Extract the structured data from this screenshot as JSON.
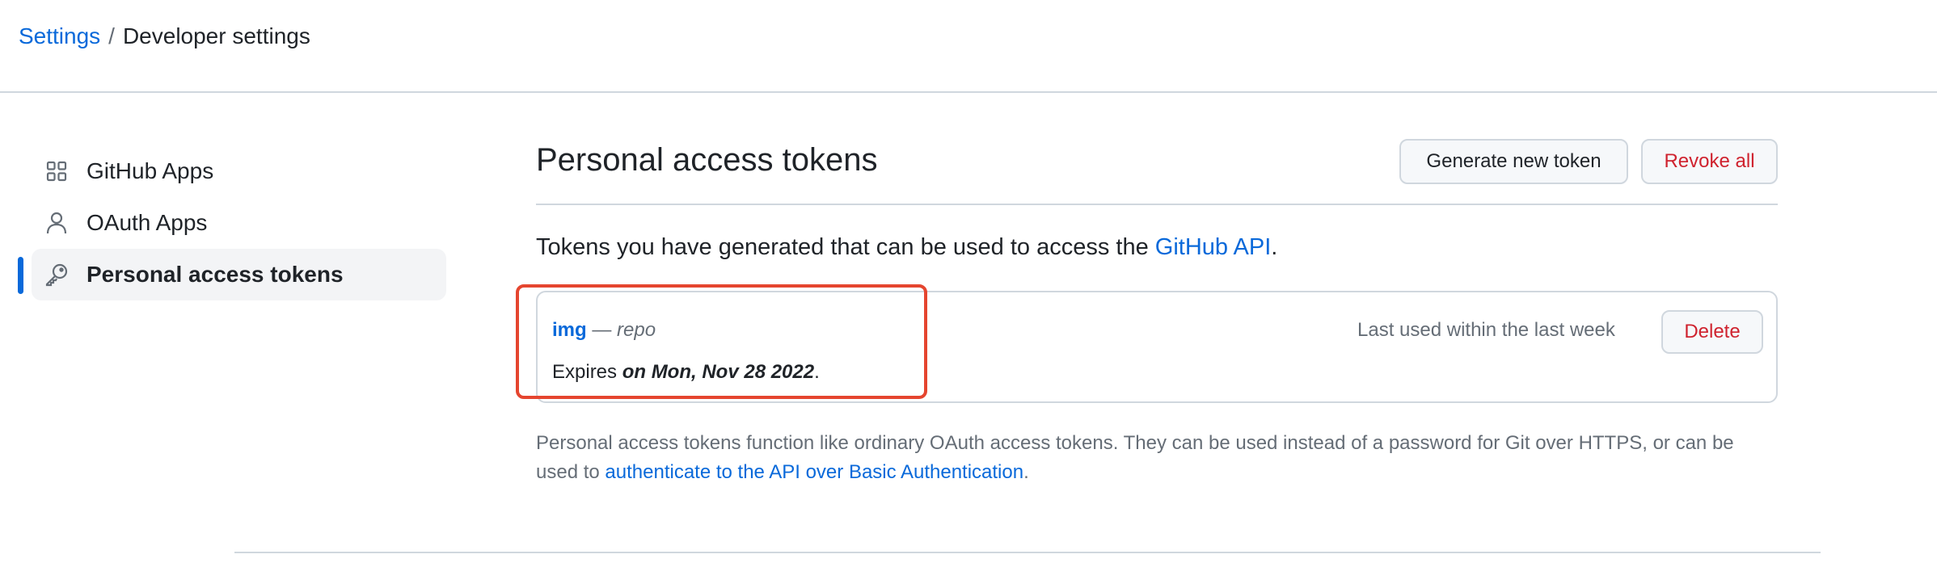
{
  "breadcrumb": {
    "root": "Settings",
    "separator": "/",
    "current": "Developer settings"
  },
  "sidebar": {
    "items": [
      {
        "label": "GitHub Apps",
        "icon": "apps-grid-icon"
      },
      {
        "label": "OAuth Apps",
        "icon": "person-icon"
      },
      {
        "label": "Personal access tokens",
        "icon": "key-icon",
        "active": true
      }
    ]
  },
  "main": {
    "title": "Personal access tokens",
    "generate_label": "Generate new token",
    "revoke_all_label": "Revoke all",
    "intro_text": "Tokens you have generated that can be used to access the ",
    "intro_link": "GitHub API",
    "intro_end": "."
  },
  "token": {
    "name": "img",
    "dash": " — ",
    "scope": "repo",
    "expires_prefix": "Expires ",
    "expires_date": "on Mon, Nov 28 2022",
    "expires_end": ".",
    "last_used": "Last used within the last week",
    "delete_label": "Delete"
  },
  "footnote": {
    "text": "Personal access tokens function like ordinary OAuth access tokens. They can be used instead of a password for Git over HTTPS, or can be used to ",
    "link": "authenticate to the API over Basic Authentication",
    "end": "."
  },
  "colors": {
    "accent": "#0969da",
    "danger": "#cf222e",
    "highlight": "#e5452f"
  }
}
